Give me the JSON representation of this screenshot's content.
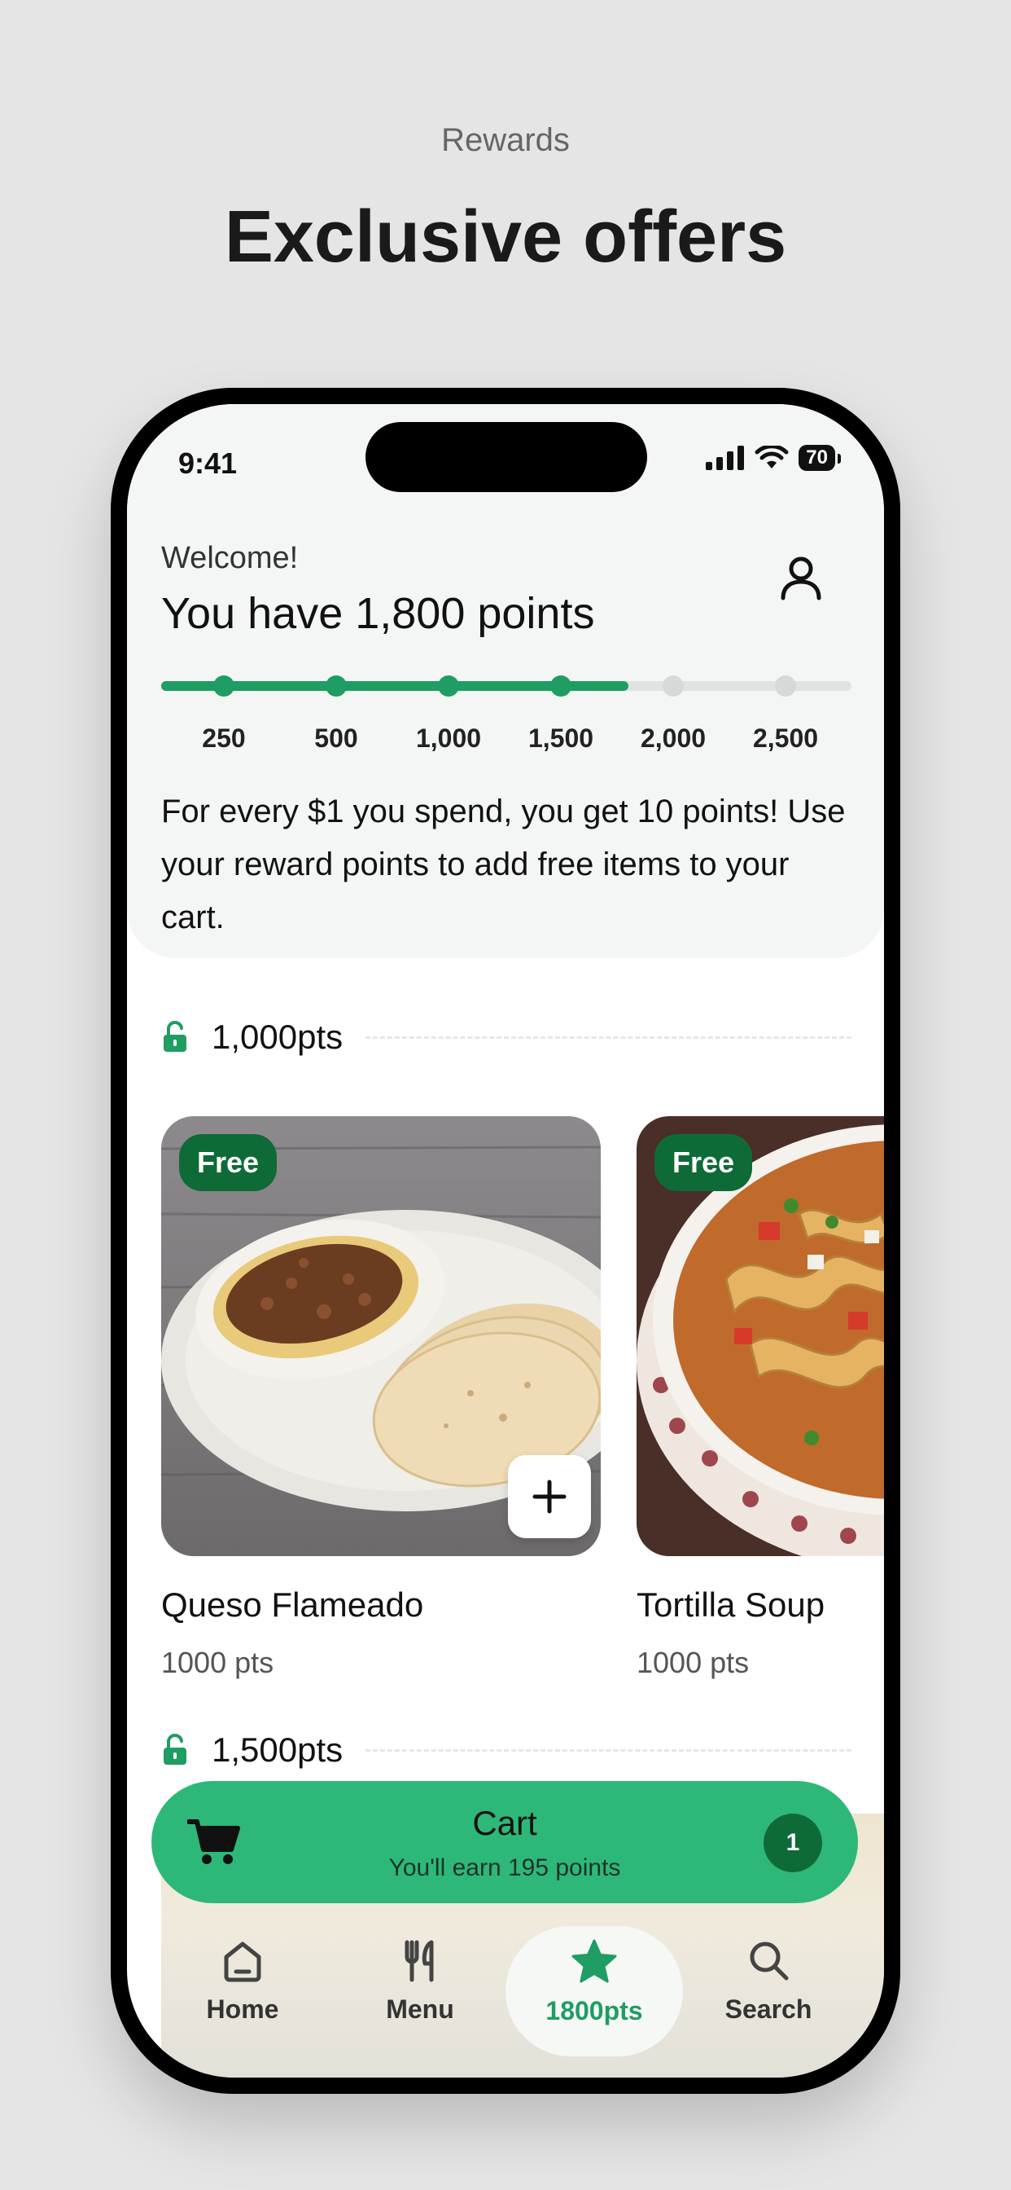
{
  "promo": {
    "kicker": "Rewards",
    "headline": "Exclusive offers"
  },
  "status": {
    "time": "9:41",
    "battery": "70"
  },
  "header": {
    "welcome": "Welcome!",
    "points_title": "You have 1,800 points",
    "description": "For every $1 you spend, you get 10 points! Use your reward points to add free items to your cart."
  },
  "progress": {
    "current_points": 1800,
    "max_points": 2500,
    "milestones": [
      "250",
      "500",
      "1,000",
      "1,500",
      "2,000",
      "2,500"
    ],
    "reached": [
      true,
      true,
      true,
      true,
      false,
      false
    ]
  },
  "tiers": [
    {
      "label": "1,000pts"
    },
    {
      "label": "1,500pts"
    }
  ],
  "items": [
    {
      "badge": "Free",
      "name": "Queso Flameado",
      "pts": "1000 pts"
    },
    {
      "badge": "Free",
      "name": "Tortilla Soup",
      "pts": "1000 pts"
    }
  ],
  "cart": {
    "title": "Cart",
    "subtitle": "You'll earn 195 points",
    "count": "1"
  },
  "tabs": [
    {
      "label": "Home",
      "icon": "home-icon"
    },
    {
      "label": "Menu",
      "icon": "utensils-icon"
    },
    {
      "label": "1800pts",
      "icon": "star-icon"
    },
    {
      "label": "Search",
      "icon": "search-icon"
    }
  ],
  "colors": {
    "accent": "#1f9d62",
    "cart": "#2db87a",
    "badge": "#0e6b37"
  }
}
